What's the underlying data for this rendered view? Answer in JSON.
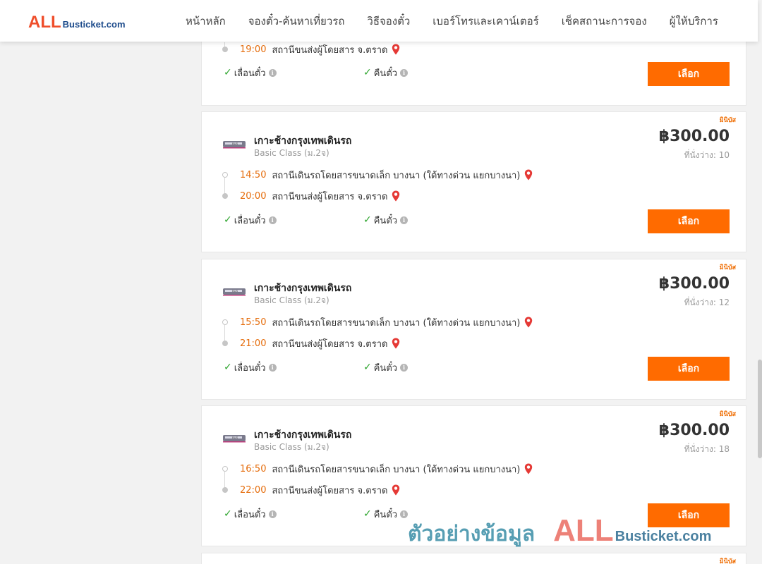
{
  "header": {
    "logo_all": "ALL",
    "logo_rest": "Busticket.com",
    "nav": [
      "หน้าหลัก",
      "จองตั๋ว-ค้นหาเที่ยวรถ",
      "วิธีจองตั๋ว",
      "เบอร์โทรและเคาน์เตอร์",
      "เช็คสถานะการจอง",
      "ผู้ให้บริการ"
    ]
  },
  "top_partial": {
    "arrival_time": "19:00",
    "arrival_place": "สถานีขนส่งผู้โดยสาร จ.ตราด",
    "feature_change": "เลื่อนตั๋ว",
    "feature_refund": "คืนตั๋ว",
    "select_label": "เลือก"
  },
  "trips": [
    {
      "badge": "มินิบัส",
      "route": "เกาะช้างกรุงเทพเดินรถ",
      "bus_class": "Basic Class (ม.2จ)",
      "price": "฿300.00",
      "seats": "ที่นั่งว่าง: 10",
      "depart_time": "14:50",
      "depart_place": "สถานีเดินรถโดยสารขนาดเล็ก บางนา (ใต้ทางด่วน แยกบางนา)",
      "arrive_time": "20:00",
      "arrive_place": "สถานีขนส่งผู้โดยสาร จ.ตราด",
      "feature_change": "เลื่อนตั๋ว",
      "feature_refund": "คืนตั๋ว",
      "select_label": "เลือก"
    },
    {
      "badge": "มินิบัส",
      "route": "เกาะช้างกรุงเทพเดินรถ",
      "bus_class": "Basic Class (ม.2จ)",
      "price": "฿300.00",
      "seats": "ที่นั่งว่าง: 12",
      "depart_time": "15:50",
      "depart_place": "สถานีเดินรถโดยสารขนาดเล็ก บางนา (ใต้ทางด่วน แยกบางนา)",
      "arrive_time": "21:00",
      "arrive_place": "สถานีขนส่งผู้โดยสาร จ.ตราด",
      "feature_change": "เลื่อนตั๋ว",
      "feature_refund": "คืนตั๋ว",
      "select_label": "เลือก"
    },
    {
      "badge": "มินิบัส",
      "route": "เกาะช้างกรุงเทพเดินรถ",
      "bus_class": "Basic Class (ม.2จ)",
      "price": "฿300.00",
      "seats": "ที่นั่งว่าง: 18",
      "depart_time": "16:50",
      "depart_place": "สถานีเดินรถโดยสารขนาดเล็ก บางนา (ใต้ทางด่วน แยกบางนา)",
      "arrive_time": "22:00",
      "arrive_place": "สถานีขนส่งผู้โดยสาร จ.ตราด",
      "feature_change": "เลื่อนตั๋ว",
      "feature_refund": "คืนตั๋ว",
      "select_label": "เลือก"
    }
  ],
  "bottom_partial": {
    "badge": "มินิบัส"
  },
  "watermark": {
    "text": "ตัวอย่างข้อมูล",
    "logo_all": "ALL",
    "logo_rest": "Busticket.com"
  },
  "colors": {
    "accent": "#ff6b00",
    "time": "#e56c0b",
    "check": "#2ea52e",
    "pin": "#e53935",
    "logo_all": "#ef4e2b",
    "logo_rest": "#1e4c8c"
  },
  "icons": {
    "pin": "map-pin-icon",
    "check": "check-icon",
    "info": "info-icon",
    "bus": "bus-company-logo"
  }
}
